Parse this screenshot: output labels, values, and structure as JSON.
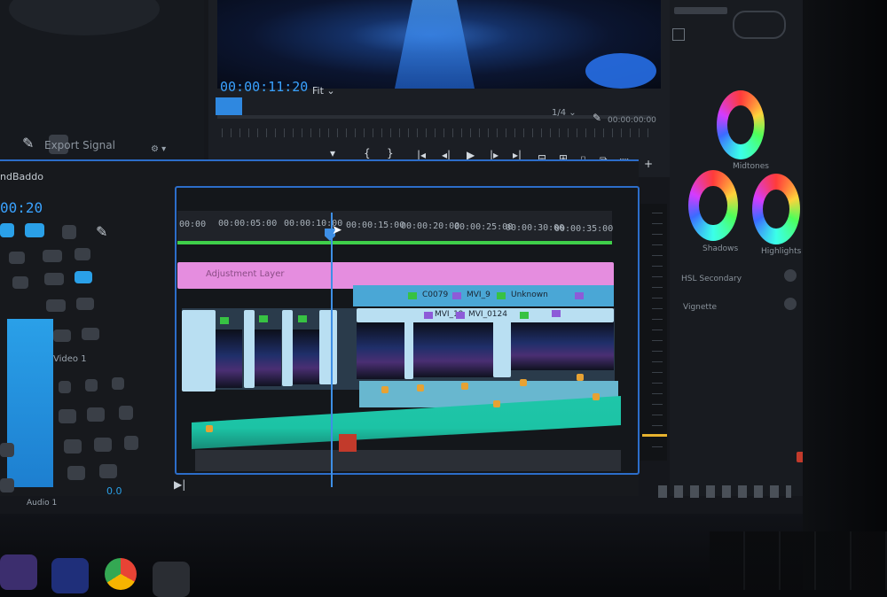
{
  "program_monitor": {
    "timecode": "00:00:11:20",
    "zoom_select": "Fit",
    "resolution": "1/4",
    "duration": "00:00:00:00",
    "transport": [
      "▾",
      "{",
      "}",
      "|◂",
      "◂|",
      "▶",
      "|▸",
      "▸|",
      "⊟",
      "⊞",
      "⌷",
      "⧉",
      "⬚",
      "+"
    ]
  },
  "source_panel": {
    "export_frame_label": "Export Signal",
    "selection_label": "ndBaddo",
    "tool_timecode": "00:20"
  },
  "timeline": {
    "ruler_ticks": [
      "00:00",
      "00:00:05:00",
      "00:00:10:00",
      "00:00:15:00",
      "00:00:20:00",
      "00:00:25:00",
      "00:00:30:00",
      "00:00:35:00"
    ],
    "graphic_clip_label": "Adjustment Layer",
    "v2_clip_labels": [
      "C0079",
      "MVI_9",
      "Unknown"
    ],
    "v1_clip_labels": [
      "MVI_19",
      "MVI_0124"
    ],
    "left_tool_label": "Audio 1"
  },
  "lumetri": {
    "wheel_labels": [
      "Midtones",
      "Shadows",
      "Highlights"
    ],
    "row_labels": [
      "HSL Secondary",
      "Vignette"
    ]
  },
  "colors": {
    "accent": "#3aa2ff",
    "graphic_clip": "#e58ddf",
    "audio": "#1fc6a9",
    "playhead": "#3e8fe6"
  },
  "icons": [
    "wrench-icon",
    "camera-icon",
    "play-icon",
    "step-back-icon",
    "step-forward-icon",
    "chrome-icon",
    "folder-icon"
  ]
}
